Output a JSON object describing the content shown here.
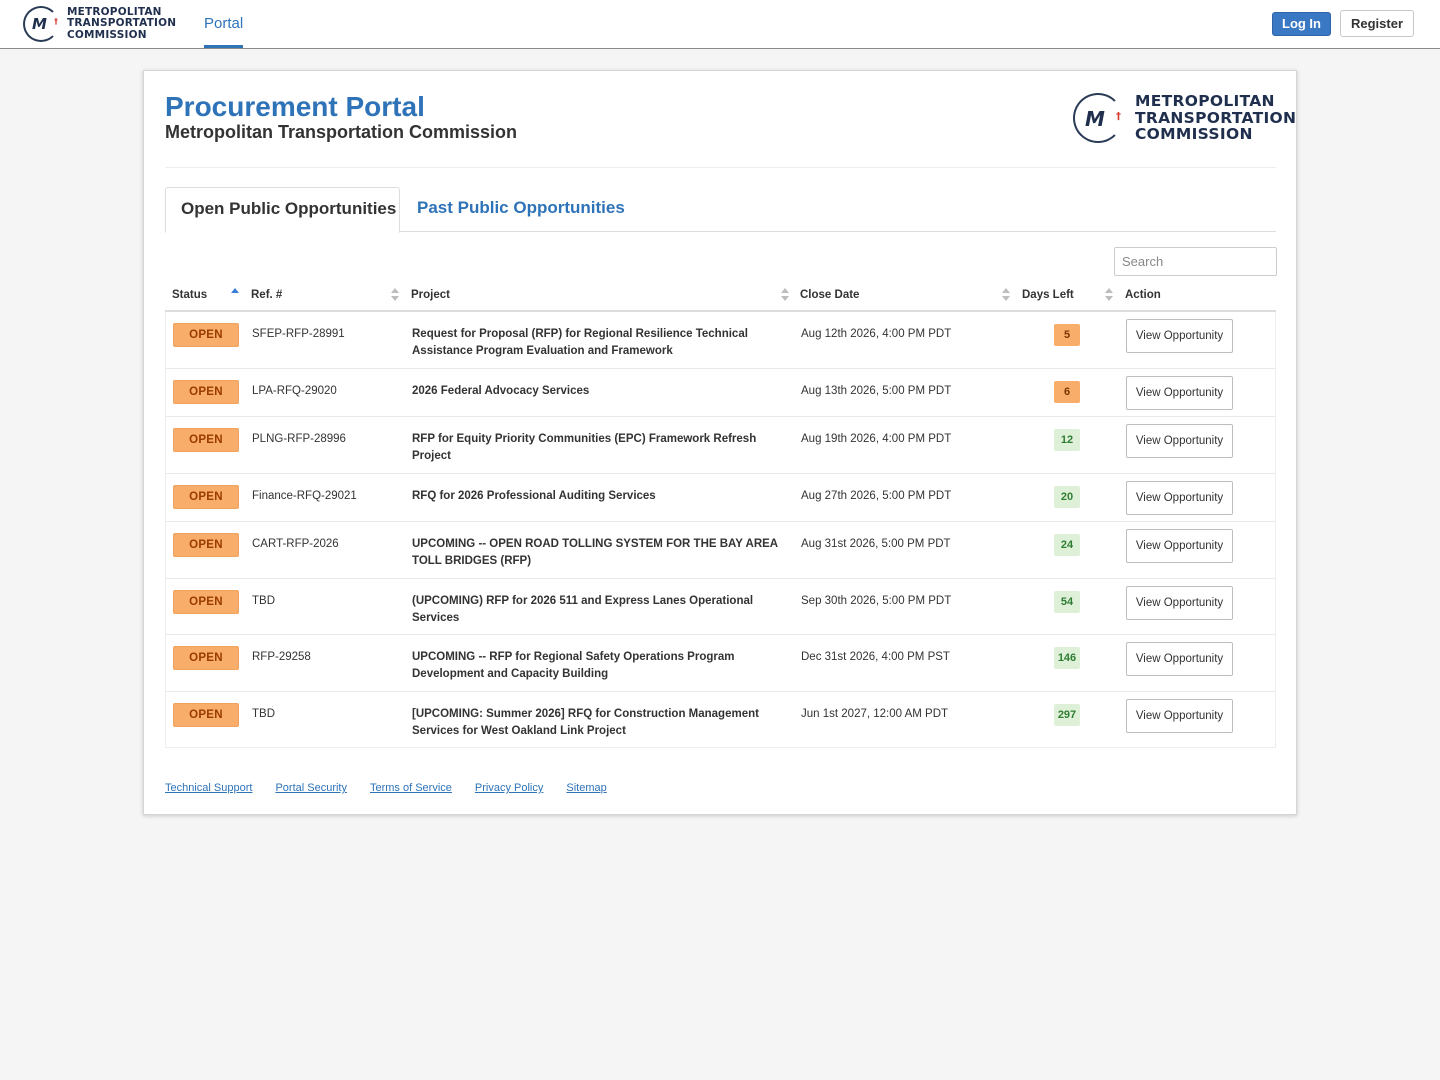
{
  "nav": {
    "logo_lines": [
      "METROPOLITAN",
      "TRANSPORTATION",
      "COMMISSION"
    ],
    "logo_mark": "M",
    "portal_link": "Portal",
    "login_label": "Log In",
    "register_label": "Register"
  },
  "header": {
    "title": "Procurement Portal",
    "subtitle": "Metropolitan Transportation Commission",
    "logo_lines": [
      "METROPOLITAN",
      "TRANSPORTATION",
      "COMMISSION"
    ]
  },
  "tabs": [
    {
      "label": "Open Public Opportunities",
      "active": true
    },
    {
      "label": "Past Public Opportunities",
      "active": false
    }
  ],
  "search": {
    "placeholder": "Search",
    "value": ""
  },
  "table": {
    "columns": [
      "Status",
      "Ref. #",
      "Project",
      "Close Date",
      "Days Left",
      "Action"
    ],
    "rows": [
      {
        "status": "OPEN",
        "ref": "SFEP-RFP-28991",
        "project": "Request for Proposal (RFP) for Regional Resilience Technical Assistance Program Evaluation and Framework",
        "close_date": "Aug 12th 2026, 4:00 PM PDT",
        "days_left": "5",
        "urgency": "warn",
        "action": "View Opportunity"
      },
      {
        "status": "OPEN",
        "ref": "LPA-RFQ-29020",
        "project": "2026 Federal Advocacy Services",
        "close_date": "Aug 13th 2026, 5:00 PM PDT",
        "days_left": "6",
        "urgency": "warn",
        "action": "View Opportunity"
      },
      {
        "status": "OPEN",
        "ref": "PLNG-RFP-28996",
        "project": "RFP for Equity Priority Communities (EPC) Framework Refresh Project",
        "close_date": "Aug 19th 2026, 4:00 PM PDT",
        "days_left": "12",
        "urgency": "ok",
        "action": "View Opportunity"
      },
      {
        "status": "OPEN",
        "ref": "Finance-RFQ-29021",
        "project": "RFQ for 2026 Professional Auditing Services",
        "close_date": "Aug 27th 2026, 5:00 PM PDT",
        "days_left": "20",
        "urgency": "ok",
        "action": "View Opportunity"
      },
      {
        "status": "OPEN",
        "ref": "CART-RFP-2026",
        "project": "UPCOMING -- OPEN ROAD TOLLING SYSTEM FOR THE BAY AREA TOLL BRIDGES (RFP)",
        "close_date": "Aug 31st 2026, 5:00 PM PDT",
        "days_left": "24",
        "urgency": "ok",
        "action": "View Opportunity"
      },
      {
        "status": "OPEN",
        "ref": "TBD",
        "project": "(UPCOMING) RFP for 2026 511 and Express Lanes Operational Services",
        "close_date": "Sep 30th 2026, 5:00 PM PDT",
        "days_left": "54",
        "urgency": "ok",
        "action": "View Opportunity"
      },
      {
        "status": "OPEN",
        "ref": "RFP-29258",
        "project": "UPCOMING -- RFP for Regional Safety Operations Program Development and Capacity Building",
        "close_date": "Dec 31st 2026, 4:00 PM PST",
        "days_left": "146",
        "urgency": "ok",
        "action": "View Opportunity"
      },
      {
        "status": "OPEN",
        "ref": "TBD",
        "project": "[UPCOMING: Summer 2026] RFQ for Construction Management Services for West Oakland Link Project",
        "close_date": "Jun 1st 2027, 12:00 AM PDT",
        "days_left": "297",
        "urgency": "ok",
        "action": "View Opportunity"
      }
    ]
  },
  "footer": {
    "links": [
      "Technical Support",
      "Portal Security",
      "Terms of Service",
      "Privacy Policy",
      "Sitemap"
    ]
  },
  "colors": {
    "brand_blue": "#2e73b8",
    "open_badge": "#f9ad6a",
    "days_ok": "#dff0d8",
    "logo_navy": "#1f2f4d",
    "logo_red": "#d43b2f"
  }
}
